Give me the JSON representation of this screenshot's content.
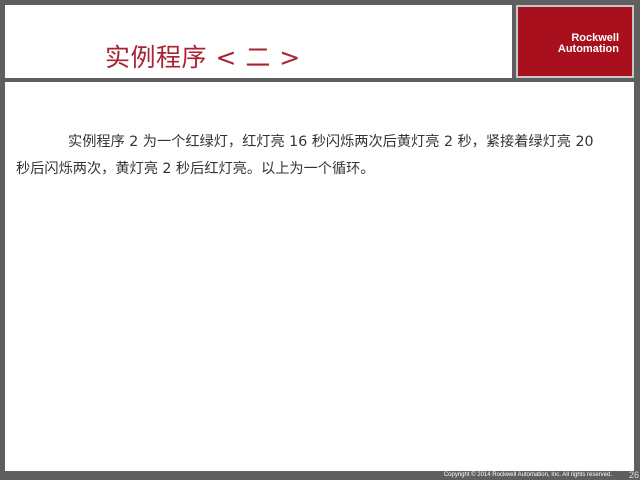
{
  "slide": {
    "title": "实例程序 < 二 >",
    "body": "实例程序 2 为一个红绿灯，红灯亮 16 秒闪烁两次后黄灯亮 2 秒，紧接着绿灯亮 20 秒后闪烁两次，黄灯亮 2 秒后红灯亮。以上为一个循环。"
  },
  "logo": {
    "line1": "Rockwell",
    "line2": "Automation"
  },
  "footer": {
    "copyright": "Copyright © 2014 Rockwell Automation, Inc. All rights reserved.",
    "page_number": "26"
  },
  "colors": {
    "title": "#a82331",
    "logo_background": "#a8101d",
    "frame": "#5f5f5f"
  }
}
